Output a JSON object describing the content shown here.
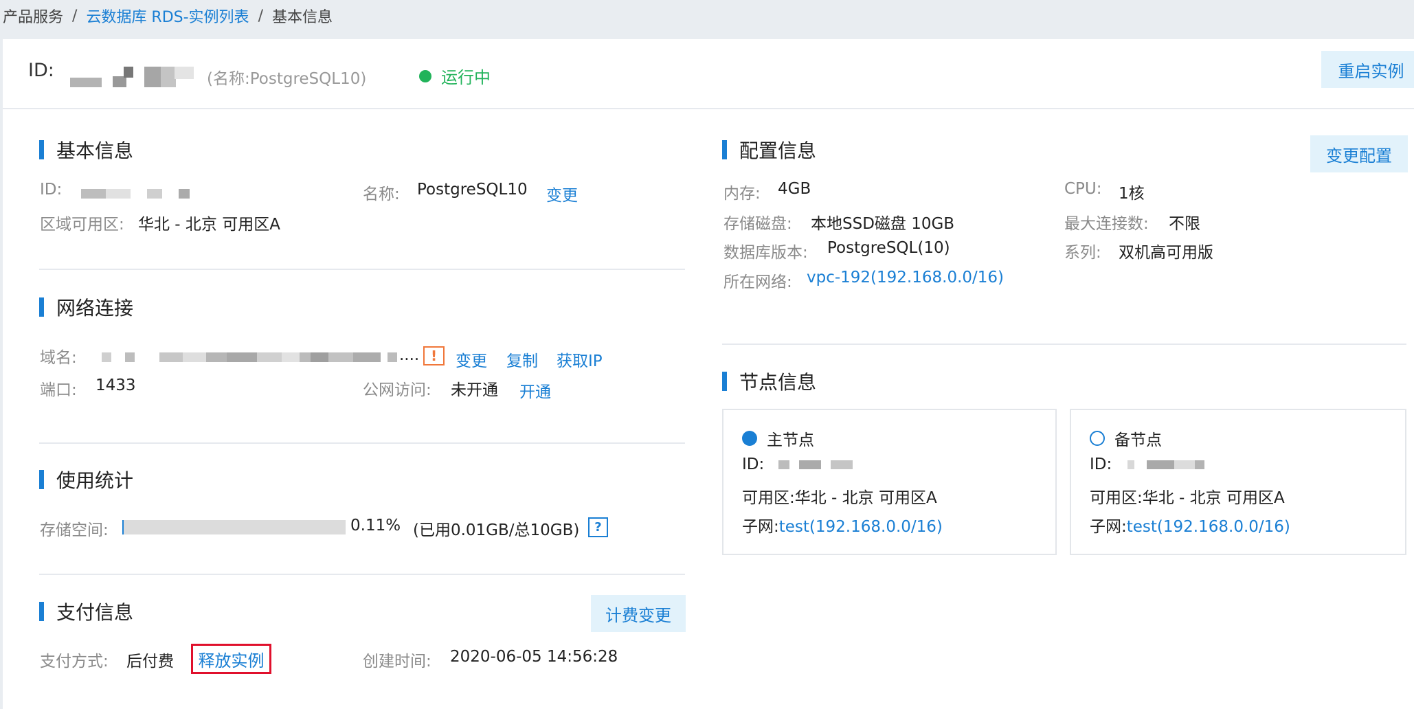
{
  "breadcrumb": {
    "items": [
      "产品服务",
      "云数据库 RDS-实例列表",
      "基本信息"
    ],
    "separator": "/"
  },
  "header": {
    "id_label": "ID:",
    "name_note": "(名称:PostgreSQL10)",
    "status": "运行中",
    "status_color": "#21b35a",
    "restart_button": "重启实例"
  },
  "basic_info": {
    "title": "基本信息",
    "id_label": "ID:",
    "name_label": "名称:",
    "name_value": "PostgreSQL10",
    "change_link": "变更",
    "region_label": "区域可用区:",
    "region_value": "华北 - 北京 可用区A"
  },
  "network": {
    "title": "网络连接",
    "domain_label": "域名:",
    "domain_ellipsis": "....",
    "warn_glyph": "!",
    "change_link": "变更",
    "copy_link": "复制",
    "get_ip_link": "获取IP",
    "port_label": "端口:",
    "port_value": "1433",
    "public_label": "公网访问:",
    "public_value": "未开通",
    "enable_link": "开通"
  },
  "usage": {
    "title": "使用统计",
    "storage_label": "存储空间:",
    "used_fraction": 0.0011,
    "percent_text": "0.11%",
    "detail_text": "(已用0.01GB/总10GB)",
    "help_glyph": "?"
  },
  "payment": {
    "title": "支付信息",
    "billing_change_button": "计费变更",
    "method_label": "支付方式:",
    "method_value": "后付费",
    "release_link": "释放实例",
    "created_label": "创建时间:",
    "created_value": "2020-06-05 14:56:28"
  },
  "config": {
    "title": "配置信息",
    "change_button": "变更配置",
    "memory_label": "内存:",
    "memory_value": "4GB",
    "cpu_label": "CPU:",
    "cpu_value": "1核",
    "disk_label": "存储磁盘:",
    "disk_value": "本地SSD磁盘 10GB",
    "maxconn_label": "最大连接数:",
    "maxconn_value": "不限",
    "version_label": "数据库版本:",
    "version_value": "PostgreSQL(10)",
    "series_label": "系列:",
    "series_value": "双机高可用版",
    "network_label": "所在网络:",
    "network_value": "vpc-192(192.168.0.0/16)"
  },
  "nodes": {
    "title": "节点信息",
    "primary": {
      "title": "主节点",
      "id_label": "ID:",
      "zone_label": "可用区:",
      "zone_value": "华北 - 北京 可用区A",
      "subnet_label": "子网:",
      "subnet_value": "test(192.168.0.0/16)"
    },
    "standby": {
      "title": "备节点",
      "id_label": "ID:",
      "zone_label": "可用区:",
      "zone_value": "华北 - 北京 可用区A",
      "subnet_label": "子网:",
      "subnet_value": "test(192.168.0.0/16)"
    }
  },
  "colors": {
    "accent": "#1a7fd4",
    "warning": "#f0773a",
    "highlight_box": "#e0102c"
  }
}
